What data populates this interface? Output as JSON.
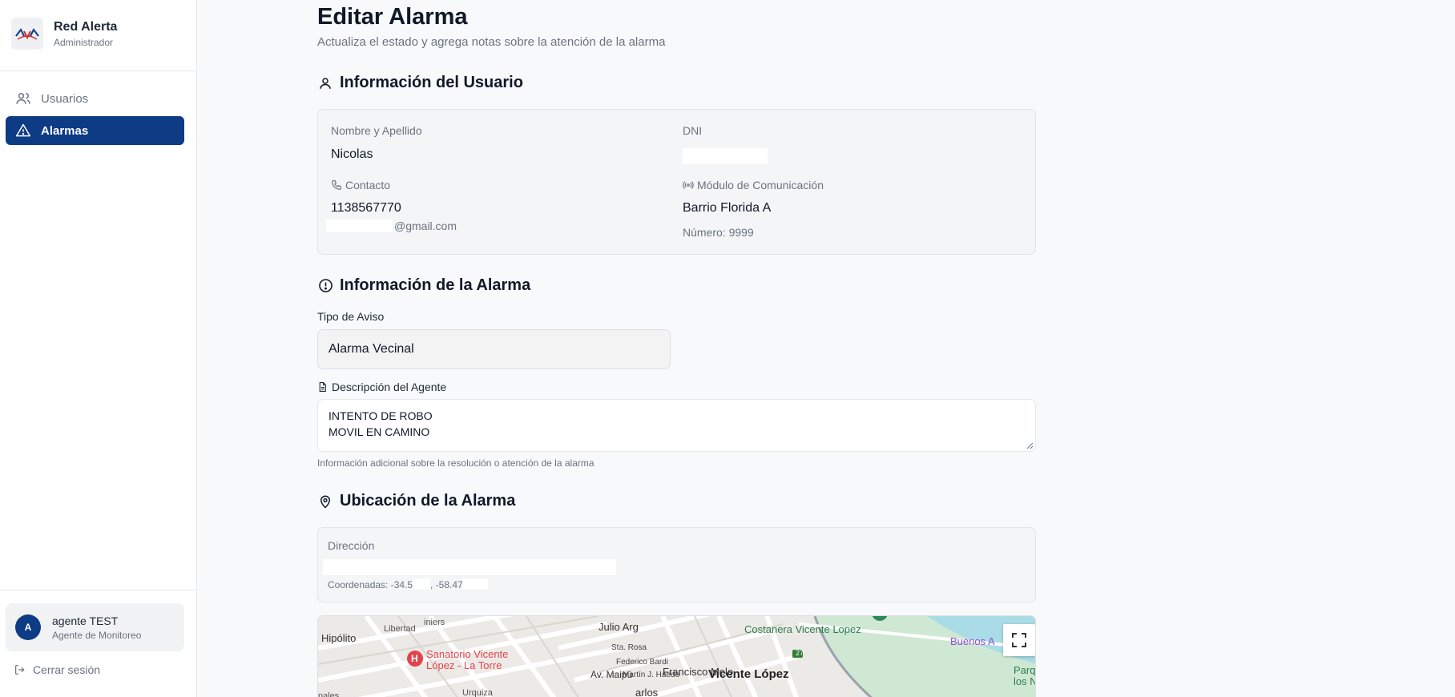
{
  "sidebar": {
    "brand_title": "Red Alerta",
    "brand_subtitle": "Administrador",
    "logo_text": "RAV",
    "items": [
      {
        "label": "Usuarios",
        "icon": "users-icon",
        "active": false
      },
      {
        "label": "Alarmas",
        "icon": "alert-triangle-icon",
        "active": true
      }
    ],
    "user": {
      "avatar_initial": "A",
      "name": "agente TEST",
      "role": "Agente de Monitoreo"
    },
    "logout_label": "Cerrar sesión"
  },
  "page": {
    "title": "Editar Alarma",
    "subtitle": "Actualiza el estado y agrega notas sobre la atención de la alarma"
  },
  "user_info": {
    "section_title": "Información del Usuario",
    "name_label": "Nombre y Apellido",
    "name_value": "Nicolas",
    "dni_label": "DNI",
    "contact_label": "Contacto",
    "phone": "1138567770",
    "email_suffix": "@gmail.com",
    "module_label": "Módulo de Comunicación",
    "module_value": "Barrio Florida A",
    "module_number": "Número: 9999"
  },
  "alarm_info": {
    "section_title": "Información de la Alarma",
    "type_label": "Tipo de Aviso",
    "type_value": "Alarma Vecinal",
    "desc_label": "Descripción del Agente",
    "desc_lines": [
      "INTENTO DE ROBO",
      "MOVIL EN CAMINO"
    ],
    "helper": "Información adicional sobre la resolución o atención de la alarma"
  },
  "location": {
    "section_title": "Ubicación de la Alarma",
    "address_label": "Dirección",
    "coords_prefix": "Coordenadas: -34.53",
    "coords_lng": ", -58.47"
  },
  "map": {
    "labels": {
      "hipolito": "Hipólito",
      "libertad": "Libertad",
      "uriarte": "iniers",
      "julio": "Julio Arg",
      "sanatorio_1": "Sanatorio Vicente",
      "sanatorio_2": "López - La Torre",
      "costanera": "Costanera Vicente Lopez",
      "buenos": "Buenos A",
      "parque_1": "Parqu",
      "parque_2": "los N",
      "vicente": "Vicente López",
      "sta_rosa": "Sta. Rosa",
      "fed_bardi": "Federico Bardi",
      "martin": "Martín J. Haedo",
      "fmelo": "Francisco Melo",
      "carlos": "arlos",
      "maipu": "Av. Maipú",
      "urquiza": "Urquiza",
      "nales": "nales",
      "route": "27",
      "poi_letter": "H"
    },
    "colors": {
      "poi_red": "#e4434b",
      "park_green": "#cfe8d4",
      "water": "#a9dce6",
      "purple": "#8a4fd6"
    }
  },
  "colors": {
    "accent": "#0d3b84"
  }
}
